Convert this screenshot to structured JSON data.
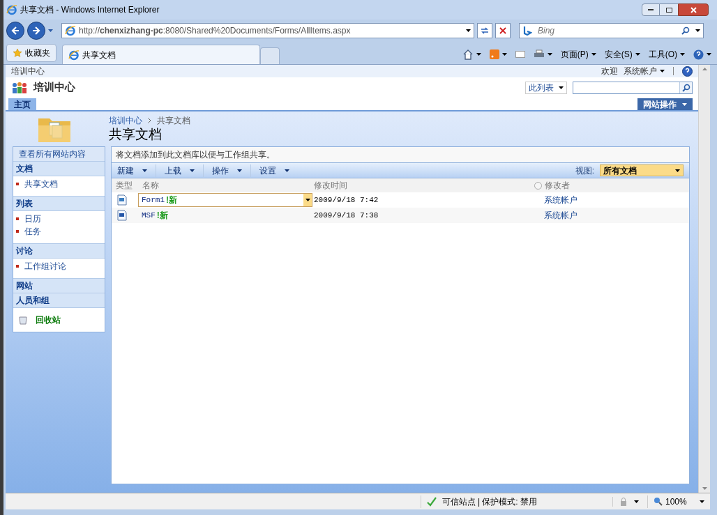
{
  "window": {
    "title": "共享文档 - Windows Internet Explorer"
  },
  "address_bar": {
    "url": "http://**chenxizhang-pc**:8080/Shared%20Documents/Forms/AllItems.aspx"
  },
  "search_box": {
    "placeholder": "Bing"
  },
  "favorites_button": "收藏夹",
  "browser_tabs": [
    {
      "label": "共享文档",
      "selected": true
    }
  ],
  "command_menus": [
    "页面(P)",
    "安全(S)",
    "工具(O)"
  ],
  "site": {
    "top_link": "培训中心",
    "welcome": "欢迎",
    "user": "系统帐户",
    "title": "培训中心",
    "search_scope": "此列表",
    "tabs": [
      {
        "label": "主页",
        "selected": true
      }
    ],
    "site_actions": "网站操作"
  },
  "page": {
    "breadcrumb": [
      "培训中心",
      "共享文档"
    ],
    "title": "共享文档",
    "description": "将文档添加到此文档库以便与工作组共享。"
  },
  "quick_launch": {
    "top_link": "查看所有网站内容",
    "sections": [
      {
        "heading": "文档",
        "items": [
          "共享文档"
        ]
      },
      {
        "heading": "列表",
        "items": [
          "日历",
          "任务"
        ]
      },
      {
        "heading": "讨论",
        "items": [
          "工作组讨论"
        ]
      },
      {
        "heading": "网站"
      },
      {
        "heading": "人员和组"
      }
    ],
    "recycle_bin": "回收站"
  },
  "toolbar": {
    "menus": [
      "新建",
      "上载",
      "操作",
      "设置"
    ],
    "view_label": "视图:",
    "view": "所有文档"
  },
  "table": {
    "columns": [
      "类型",
      "名称",
      "修改时间",
      "修改者"
    ],
    "rows": [
      {
        "kind": "form",
        "name": "Form1",
        "new_mark": "!新",
        "modified": "2009/9/18 7:42",
        "modified_by": "系统帐户",
        "selected": true
      },
      {
        "kind": "document",
        "name": "MSF",
        "new_mark": "!新",
        "modified": "2009/9/18 7:38",
        "modified_by": "系统帐户",
        "selected": false
      }
    ]
  },
  "status_bar": {
    "zone": "可信站点 | 保护模式: 禁用",
    "zoom": "100%"
  }
}
